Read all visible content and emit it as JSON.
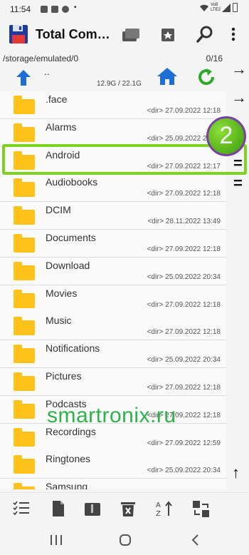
{
  "status": {
    "time": "11:54",
    "signal_text": "Vo8 LTE2"
  },
  "app": {
    "title": "Total Com…"
  },
  "path": {
    "current": "/storage/emulated/0",
    "count": "0/16",
    "parent": "..",
    "space": "12.9G / 22.1G"
  },
  "files": [
    {
      "name": ".face",
      "meta": "<dir> 27.09.2022 12:18"
    },
    {
      "name": "Alarms",
      "meta": "<dir> 25.09.2022 20:34"
    },
    {
      "name": "Android",
      "meta": "<dir> 27.09.2022 12:17"
    },
    {
      "name": "Audiobooks",
      "meta": "<dir> 27.09.2022 12:18"
    },
    {
      "name": "DCIM",
      "meta": "<dir> 28.11.2022 13:49"
    },
    {
      "name": "Documents",
      "meta": "<dir> 27.09.2022 12:18"
    },
    {
      "name": "Download",
      "meta": "<dir> 25.09.2022 20:34"
    },
    {
      "name": "Movies",
      "meta": "<dir> 27.09.2022 12:18"
    },
    {
      "name": "Music",
      "meta": "<dir> 27.09.2022 12:18"
    },
    {
      "name": "Notifications",
      "meta": "<dir> 25.09.2022 20:34"
    },
    {
      "name": "Pictures",
      "meta": "<dir> 27.09.2022 12:18"
    },
    {
      "name": "Podcasts",
      "meta": "<dir> 27.09.2022 12:18"
    },
    {
      "name": "Recordings",
      "meta": "<dir> 27.09.2022 12:59"
    },
    {
      "name": "Ringtones",
      "meta": "<dir> 25.09.2022 20:34"
    },
    {
      "name": "Samsung",
      "meta": ""
    }
  ],
  "annotation": {
    "badge": "2",
    "watermark": "smartronix.ru"
  },
  "side": {
    "arrow1": "→",
    "arrow2": "→",
    "eq1": "=",
    "eq2": "=",
    "up": "↑"
  },
  "colors": {
    "folder": "#ffc21a",
    "highlight": "#7ed321",
    "accent_blue": "#1d6fd6",
    "accent_green": "#2db34a"
  },
  "toolbar_icons": [
    "select-icon",
    "file-icon",
    "archive-icon",
    "delete-icon",
    "sort-icon",
    "swap-icon"
  ],
  "navbar_icons": [
    "recent-apps-icon",
    "home-icon",
    "back-icon"
  ]
}
